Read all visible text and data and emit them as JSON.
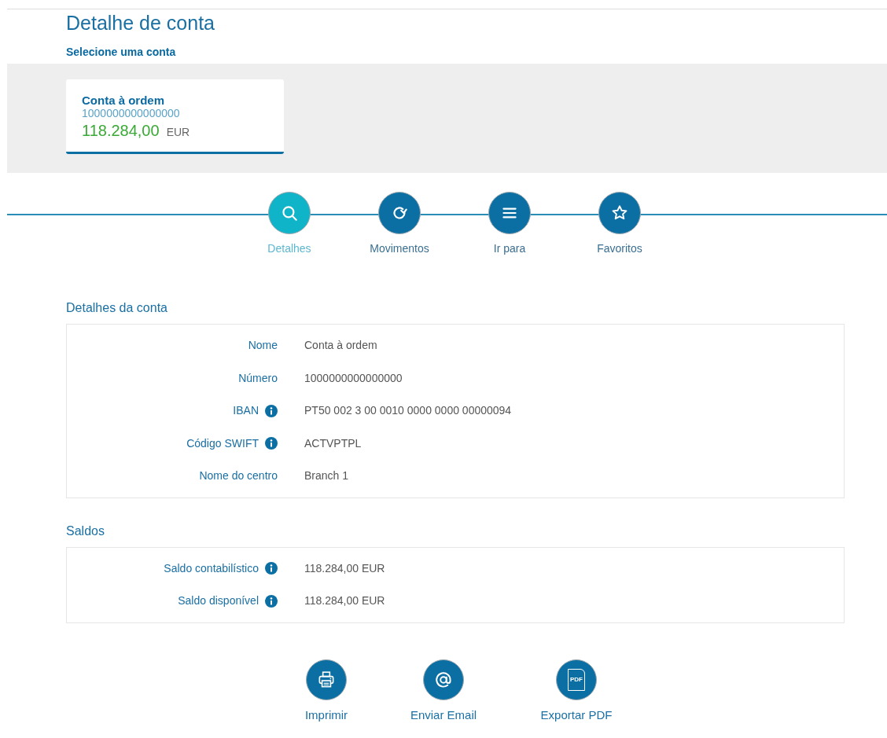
{
  "page_title": "Detalhe de conta",
  "account_selector": {
    "label": "Selecione uma conta",
    "accounts": [
      {
        "name": "Conta à ordem",
        "number": "1000000000000000",
        "balance": "118.284,00",
        "currency": "EUR",
        "selected": true
      }
    ]
  },
  "nav_tabs": [
    {
      "label": "Detalhes",
      "selected": true
    },
    {
      "label": "Movimentos",
      "selected": false
    },
    {
      "label": "Ir para",
      "selected": false
    },
    {
      "label": "Favoritos",
      "selected": false
    }
  ],
  "sections": [
    {
      "title": "Detalhes da conta",
      "rows": [
        {
          "label": "Nome",
          "value": "Conta à ordem",
          "info": false
        },
        {
          "label": "Número",
          "value": "1000000000000000",
          "info": false
        },
        {
          "label": "IBAN",
          "value": "PT50 002 3 00 0010 0000 0000 00000094",
          "info": true
        },
        {
          "label": "Código SWIFT",
          "value": "ACTVPTPL",
          "info": true
        },
        {
          "label": "Nome do centro",
          "value": "Branch 1",
          "info": false
        }
      ]
    },
    {
      "title": "Saldos",
      "rows": [
        {
          "label": "Saldo contabilístico",
          "value": "118.284,00 EUR",
          "info": true
        },
        {
          "label": "Saldo disponível",
          "value": "118.284,00 EUR",
          "info": true
        }
      ]
    }
  ],
  "actions": [
    {
      "label": "Imprimir"
    },
    {
      "label": "Enviar Email"
    },
    {
      "label": "Exportar PDF",
      "icon_text": "PDF"
    }
  ]
}
